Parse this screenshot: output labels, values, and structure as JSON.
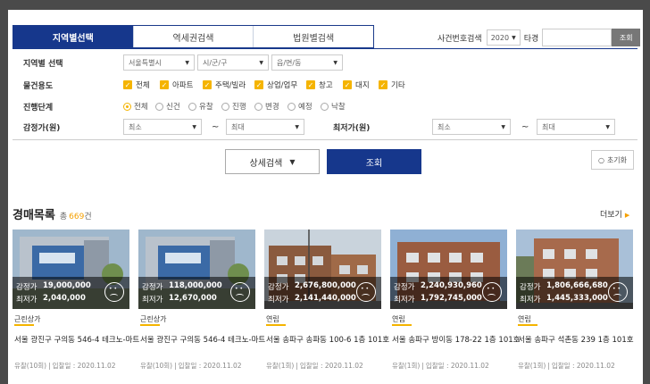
{
  "tabs": [
    "지역별선택",
    "역세권검색",
    "법원별검색"
  ],
  "case_search": {
    "label": "사건번호검색",
    "year": "2020",
    "separator": "타경",
    "button": "조회"
  },
  "filters": {
    "region": {
      "label": "지역별 선택",
      "selects": [
        "서울특별시",
        "시/군/구",
        "읍/면/동"
      ]
    },
    "usage": {
      "label": "물건용도",
      "options": [
        "전체",
        "아파트",
        "주택/빌라",
        "상업/업무",
        "창고",
        "대지",
        "기타"
      ]
    },
    "stage": {
      "label": "진행단계",
      "options": [
        "전체",
        "신건",
        "유찰",
        "진행",
        "변경",
        "예정",
        "낙찰"
      ],
      "selected": "전체"
    },
    "appraisal": {
      "label": "감정가(원)",
      "min": "최소",
      "max": "최대",
      "tilde": "~"
    },
    "minimum": {
      "label": "최저가(원)",
      "min": "최소",
      "max": "최대",
      "tilde": "~"
    }
  },
  "buttons": {
    "detail": "상세검색",
    "search": "조회",
    "reset": "초기화"
  },
  "list": {
    "title": "경매목록",
    "count_prefix": "총",
    "count": "669",
    "count_suffix": "건",
    "more": "더보기"
  },
  "cards": [
    {
      "appraisal_label": "감정가",
      "appraisal": "19,000,000",
      "minimum_label": "최저가",
      "minimum": "2,040,000",
      "category": "근린상가",
      "address": "서울 광진구 구의동 546-4 테크노-마트",
      "status": "유찰(10회)",
      "date": "입찰일 : 2020.11.02"
    },
    {
      "appraisal_label": "감정가",
      "appraisal": "118,000,000",
      "minimum_label": "최저가",
      "minimum": "12,670,000",
      "category": "근린상가",
      "address": "서울 광진구 구의동 546-4 테크노-마트",
      "status": "유찰(10회)",
      "date": "입찰일 : 2020.11.02"
    },
    {
      "appraisal_label": "감정가",
      "appraisal": "2,676,800,000",
      "minimum_label": "최저가",
      "minimum": "2,141,440,000",
      "category": "연립",
      "address": "서울 송파구 송파동 100-6 1층 101호",
      "status": "유찰(1회)",
      "date": "입찰일 : 2020.11.02"
    },
    {
      "appraisal_label": "감정가",
      "appraisal": "2,240,930,960",
      "minimum_label": "최저가",
      "minimum": "1,792,745,000",
      "category": "연립",
      "address": "서울 송파구 방이동 178-22 1층 101호",
      "status": "유찰(1회)",
      "date": "입찰일 : 2020.11.02"
    },
    {
      "appraisal_label": "감정가",
      "appraisal": "1,806,666,680",
      "minimum_label": "최저가",
      "minimum": "1,445,333,000",
      "category": "연립",
      "address": "서울 송파구 석촌동 239 1층 101호",
      "status": "유찰(1회)",
      "date": "입찰일 : 2020.11.02"
    }
  ],
  "colors": {
    "primary": "#16378c",
    "accent": "#f5b400",
    "count": "#f5a000"
  }
}
